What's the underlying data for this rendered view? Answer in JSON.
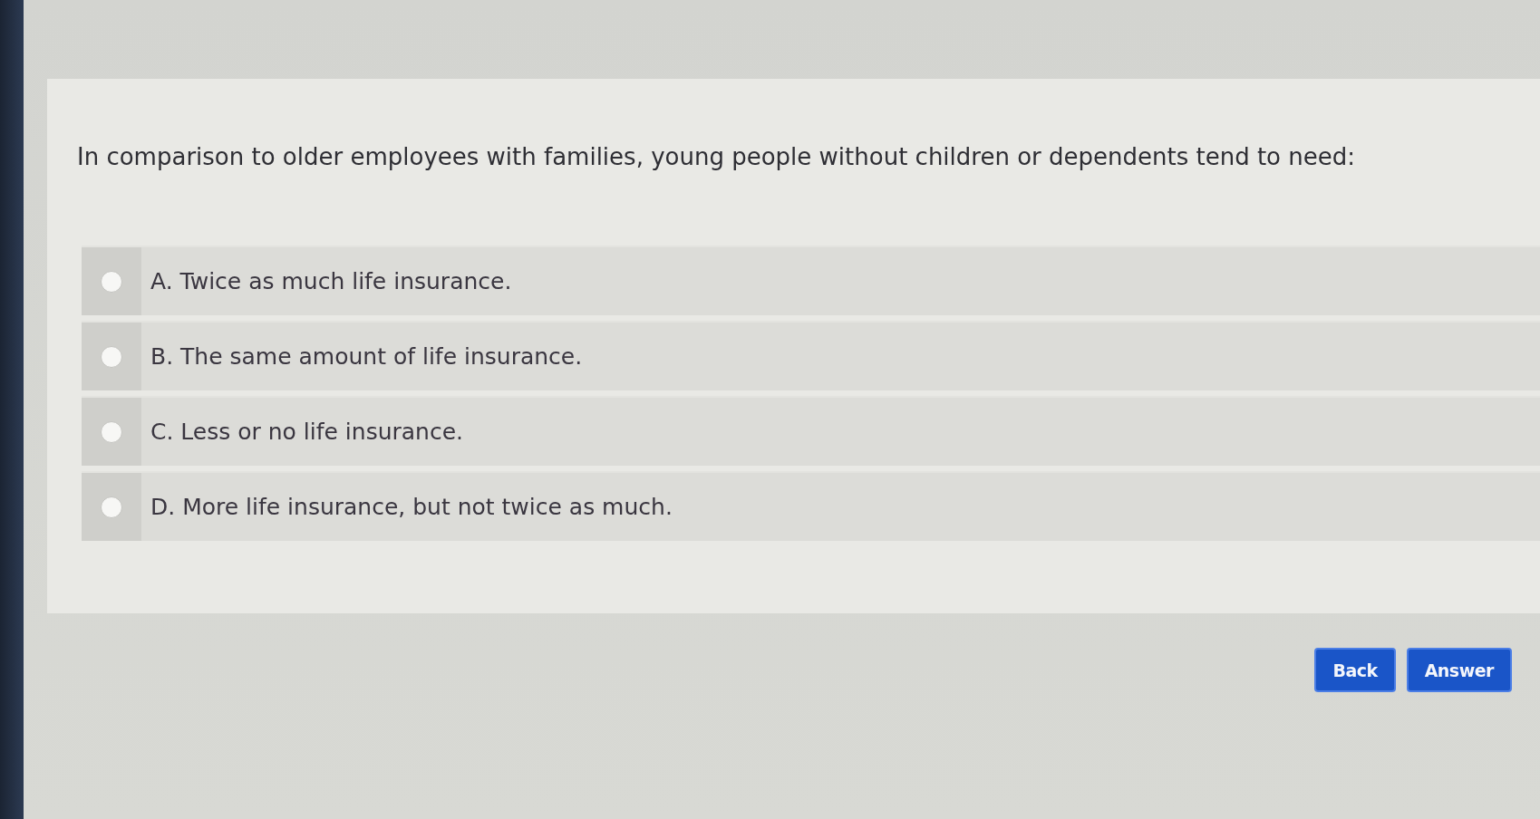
{
  "question": {
    "text": "In comparison to older employees with families, young people without children or dependents tend to need:"
  },
  "options": [
    {
      "label": "A. Twice as much life insurance.",
      "selected": false
    },
    {
      "label": "B. The same amount of life insurance.",
      "selected": false
    },
    {
      "label": "C. Less or no life insurance.",
      "selected": false
    },
    {
      "label": "D. More life insurance, but not twice as much.",
      "selected": false
    }
  ],
  "buttons": [
    {
      "label": "Back"
    },
    {
      "label": "Answer"
    }
  ]
}
